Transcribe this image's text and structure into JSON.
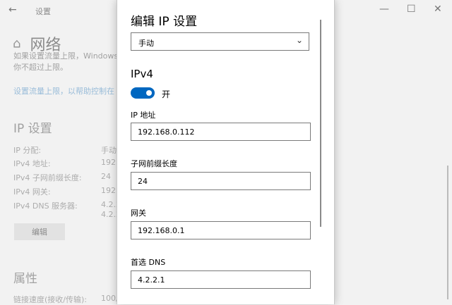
{
  "window": {
    "title": "设置",
    "back_icon": "arrow-left-icon"
  },
  "window_controls": {
    "minimize": "—",
    "maximize": "☐",
    "close": "✕"
  },
  "page": {
    "title": "网络",
    "truncated_lines": [
      "如果设置流量上限，Windows",
      "你不超过上限。"
    ],
    "link": "设置流量上限，以帮助控制在"
  },
  "ip_settings": {
    "heading": "IP 设置",
    "rows": [
      {
        "label": "IP 分配:",
        "value": "手动"
      },
      {
        "label": "IPv4 地址:",
        "value": "192."
      },
      {
        "label": "IPv4 子网前缀长度:",
        "value": "24"
      },
      {
        "label": "IPv4 网关:",
        "value": "192."
      },
      {
        "label": "IPv4 DNS 服务器:",
        "value": "4.2.2"
      }
    ],
    "dns_extra": "4.2.2",
    "edit_button": "编辑"
  },
  "properties": {
    "heading": "属性",
    "row_label": "链接速度(接收/传输):",
    "row_value": "100/"
  },
  "dialog": {
    "title": "编辑 IP 设置",
    "mode_value": "手动",
    "ipv4_heading": "IPv4",
    "toggle_label": "开",
    "ip_label": "IP 地址",
    "ip_value": "192.168.0.112",
    "prefix_label": "子网前缀长度",
    "prefix_value": "24",
    "gateway_label": "网关",
    "gateway_value": "192.168.0.1",
    "dns_label": "首选 DNS",
    "dns_value": "4.2.2.1"
  },
  "colors": {
    "accent": "#0067c0",
    "link": "#6aa0cc"
  }
}
